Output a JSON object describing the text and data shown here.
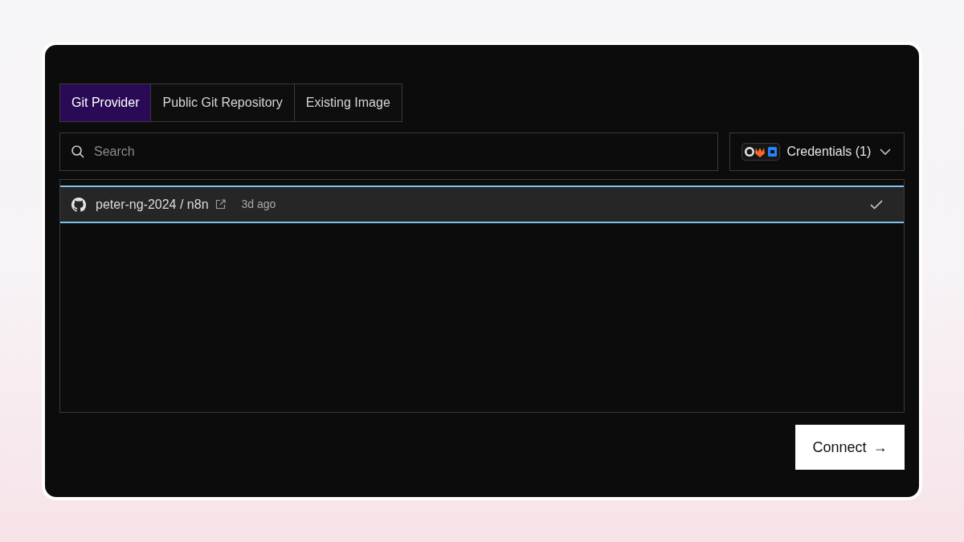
{
  "tabs": [
    {
      "label": "Git Provider",
      "selected": true
    },
    {
      "label": "Public Git Repository",
      "selected": false
    },
    {
      "label": "Existing Image",
      "selected": false
    }
  ],
  "search": {
    "placeholder": "Search"
  },
  "credentials": {
    "label": "Credentials (1)"
  },
  "repositories": [
    {
      "owner": "peter-ng-2024",
      "separator": "/",
      "name": "n8n",
      "updated": "3d ago",
      "selected": true
    }
  ],
  "connect_button": {
    "label": "Connect",
    "arrow": "→"
  }
}
